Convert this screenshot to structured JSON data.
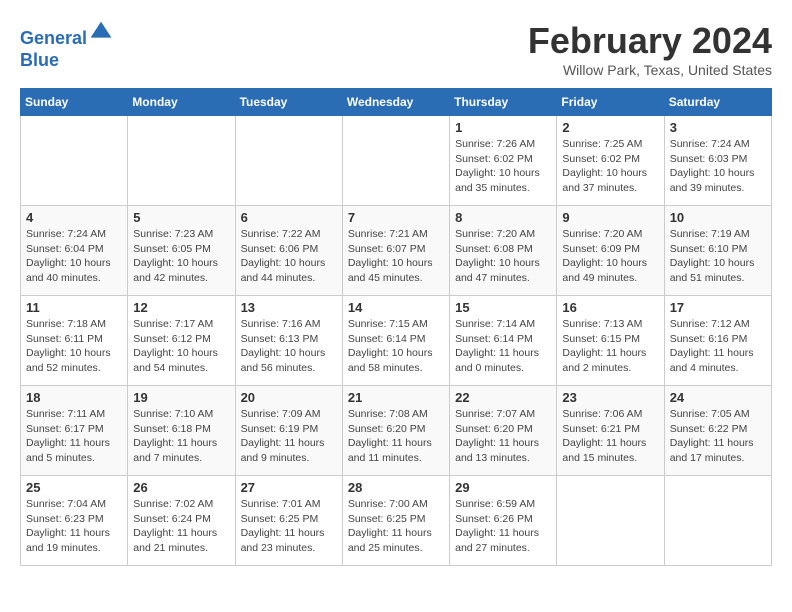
{
  "header": {
    "logo_line1": "General",
    "logo_line2": "Blue",
    "month_year": "February 2024",
    "location": "Willow Park, Texas, United States"
  },
  "days_of_week": [
    "Sunday",
    "Monday",
    "Tuesday",
    "Wednesday",
    "Thursday",
    "Friday",
    "Saturday"
  ],
  "weeks": [
    [
      {
        "day": "",
        "info": ""
      },
      {
        "day": "",
        "info": ""
      },
      {
        "day": "",
        "info": ""
      },
      {
        "day": "",
        "info": ""
      },
      {
        "day": "1",
        "info": "Sunrise: 7:26 AM\nSunset: 6:02 PM\nDaylight: 10 hours\nand 35 minutes."
      },
      {
        "day": "2",
        "info": "Sunrise: 7:25 AM\nSunset: 6:02 PM\nDaylight: 10 hours\nand 37 minutes."
      },
      {
        "day": "3",
        "info": "Sunrise: 7:24 AM\nSunset: 6:03 PM\nDaylight: 10 hours\nand 39 minutes."
      }
    ],
    [
      {
        "day": "4",
        "info": "Sunrise: 7:24 AM\nSunset: 6:04 PM\nDaylight: 10 hours\nand 40 minutes."
      },
      {
        "day": "5",
        "info": "Sunrise: 7:23 AM\nSunset: 6:05 PM\nDaylight: 10 hours\nand 42 minutes."
      },
      {
        "day": "6",
        "info": "Sunrise: 7:22 AM\nSunset: 6:06 PM\nDaylight: 10 hours\nand 44 minutes."
      },
      {
        "day": "7",
        "info": "Sunrise: 7:21 AM\nSunset: 6:07 PM\nDaylight: 10 hours\nand 45 minutes."
      },
      {
        "day": "8",
        "info": "Sunrise: 7:20 AM\nSunset: 6:08 PM\nDaylight: 10 hours\nand 47 minutes."
      },
      {
        "day": "9",
        "info": "Sunrise: 7:20 AM\nSunset: 6:09 PM\nDaylight: 10 hours\nand 49 minutes."
      },
      {
        "day": "10",
        "info": "Sunrise: 7:19 AM\nSunset: 6:10 PM\nDaylight: 10 hours\nand 51 minutes."
      }
    ],
    [
      {
        "day": "11",
        "info": "Sunrise: 7:18 AM\nSunset: 6:11 PM\nDaylight: 10 hours\nand 52 minutes."
      },
      {
        "day": "12",
        "info": "Sunrise: 7:17 AM\nSunset: 6:12 PM\nDaylight: 10 hours\nand 54 minutes."
      },
      {
        "day": "13",
        "info": "Sunrise: 7:16 AM\nSunset: 6:13 PM\nDaylight: 10 hours\nand 56 minutes."
      },
      {
        "day": "14",
        "info": "Sunrise: 7:15 AM\nSunset: 6:14 PM\nDaylight: 10 hours\nand 58 minutes."
      },
      {
        "day": "15",
        "info": "Sunrise: 7:14 AM\nSunset: 6:14 PM\nDaylight: 11 hours\nand 0 minutes."
      },
      {
        "day": "16",
        "info": "Sunrise: 7:13 AM\nSunset: 6:15 PM\nDaylight: 11 hours\nand 2 minutes."
      },
      {
        "day": "17",
        "info": "Sunrise: 7:12 AM\nSunset: 6:16 PM\nDaylight: 11 hours\nand 4 minutes."
      }
    ],
    [
      {
        "day": "18",
        "info": "Sunrise: 7:11 AM\nSunset: 6:17 PM\nDaylight: 11 hours\nand 5 minutes."
      },
      {
        "day": "19",
        "info": "Sunrise: 7:10 AM\nSunset: 6:18 PM\nDaylight: 11 hours\nand 7 minutes."
      },
      {
        "day": "20",
        "info": "Sunrise: 7:09 AM\nSunset: 6:19 PM\nDaylight: 11 hours\nand 9 minutes."
      },
      {
        "day": "21",
        "info": "Sunrise: 7:08 AM\nSunset: 6:20 PM\nDaylight: 11 hours\nand 11 minutes."
      },
      {
        "day": "22",
        "info": "Sunrise: 7:07 AM\nSunset: 6:20 PM\nDaylight: 11 hours\nand 13 minutes."
      },
      {
        "day": "23",
        "info": "Sunrise: 7:06 AM\nSunset: 6:21 PM\nDaylight: 11 hours\nand 15 minutes."
      },
      {
        "day": "24",
        "info": "Sunrise: 7:05 AM\nSunset: 6:22 PM\nDaylight: 11 hours\nand 17 minutes."
      }
    ],
    [
      {
        "day": "25",
        "info": "Sunrise: 7:04 AM\nSunset: 6:23 PM\nDaylight: 11 hours\nand 19 minutes."
      },
      {
        "day": "26",
        "info": "Sunrise: 7:02 AM\nSunset: 6:24 PM\nDaylight: 11 hours\nand 21 minutes."
      },
      {
        "day": "27",
        "info": "Sunrise: 7:01 AM\nSunset: 6:25 PM\nDaylight: 11 hours\nand 23 minutes."
      },
      {
        "day": "28",
        "info": "Sunrise: 7:00 AM\nSunset: 6:25 PM\nDaylight: 11 hours\nand 25 minutes."
      },
      {
        "day": "29",
        "info": "Sunrise: 6:59 AM\nSunset: 6:26 PM\nDaylight: 11 hours\nand 27 minutes."
      },
      {
        "day": "",
        "info": ""
      },
      {
        "day": "",
        "info": ""
      }
    ]
  ]
}
